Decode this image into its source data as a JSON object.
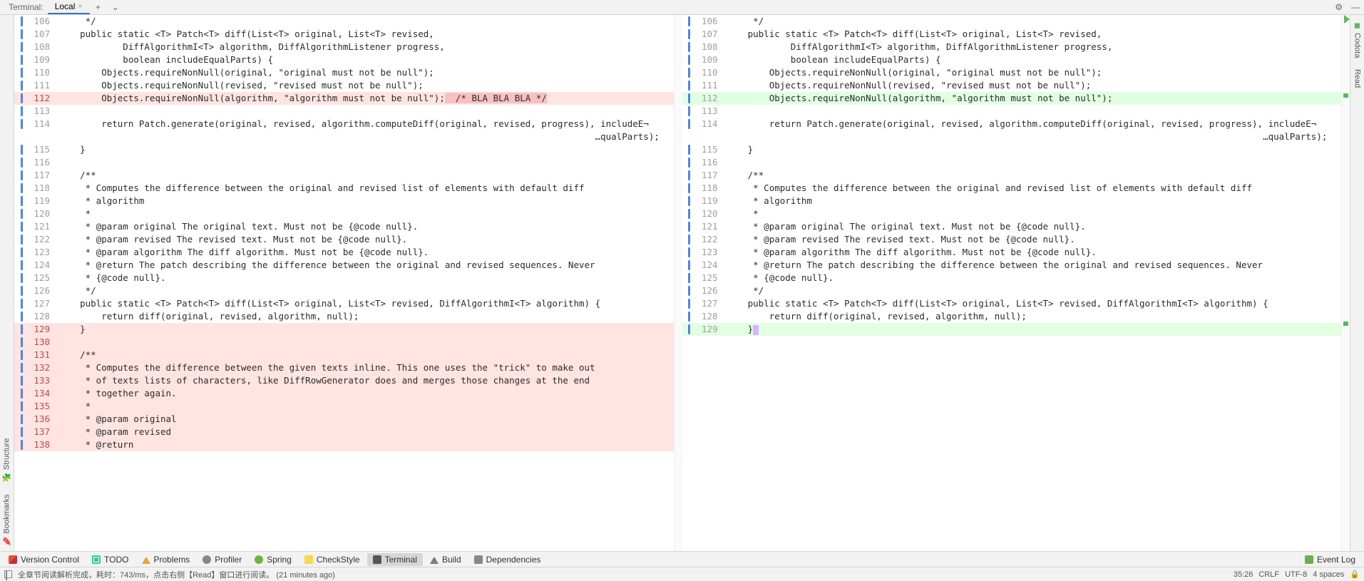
{
  "toptabs": {
    "label": "Terminal:",
    "active_tab": "Local",
    "plus": "+",
    "chevron": "⌄",
    "gear": "⚙",
    "minimize": "—"
  },
  "leftstrip": {
    "structure": "Structure",
    "bookmarks": "Bookmarks"
  },
  "rightstrip": {
    "codota": "Codota",
    "read": "Read"
  },
  "left_pane": {
    "lines": [
      {
        "n": 106,
        "t": "     */",
        "cls": ""
      },
      {
        "n": 107,
        "t": "    public static <T> Patch<T> diff(List<T> original, List<T> revised,",
        "cls": ""
      },
      {
        "n": 108,
        "t": "            DiffAlgorithmI<T> algorithm, DiffAlgorithmListener progress,",
        "cls": ""
      },
      {
        "n": 109,
        "t": "            boolean includeEqualParts) {",
        "cls": ""
      },
      {
        "n": 110,
        "t": "        Objects.requireNonNull(original, \"original must not be null\");",
        "cls": ""
      },
      {
        "n": 111,
        "t": "        Objects.requireNonNull(revised, \"revised must not be null\");",
        "cls": ""
      },
      {
        "n": 112,
        "t": "        Objects.requireNonNull(algorithm, \"algorithm must not be null\");",
        "cls": "del",
        "trail": "  /* BLA BLA BLA */"
      },
      {
        "n": 113,
        "t": "",
        "cls": ""
      },
      {
        "n": 114,
        "t": "        return Patch.generate(original, revised, algorithm.computeDiff(original, revised, progress), includeE¬",
        "cls": ""
      },
      {
        "n": 0,
        "t": "                                                                                                    …qualParts);",
        "cls": "",
        "nogut": true
      },
      {
        "n": 115,
        "t": "    }",
        "cls": ""
      },
      {
        "n": 116,
        "t": "",
        "cls": ""
      },
      {
        "n": 117,
        "t": "    /**",
        "cls": ""
      },
      {
        "n": 118,
        "t": "     * Computes the difference between the original and revised list of elements with default diff",
        "cls": ""
      },
      {
        "n": 119,
        "t": "     * algorithm",
        "cls": ""
      },
      {
        "n": 120,
        "t": "     *",
        "cls": ""
      },
      {
        "n": 121,
        "t": "     * @param original The original text. Must not be {@code null}.",
        "cls": ""
      },
      {
        "n": 122,
        "t": "     * @param revised The revised text. Must not be {@code null}.",
        "cls": ""
      },
      {
        "n": 123,
        "t": "     * @param algorithm The diff algorithm. Must not be {@code null}.",
        "cls": ""
      },
      {
        "n": 124,
        "t": "     * @return The patch describing the difference between the original and revised sequences. Never",
        "cls": ""
      },
      {
        "n": 125,
        "t": "     * {@code null}.",
        "cls": ""
      },
      {
        "n": 126,
        "t": "     */",
        "cls": ""
      },
      {
        "n": 127,
        "t": "    public static <T> Patch<T> diff(List<T> original, List<T> revised, DiffAlgorithmI<T> algorithm) {",
        "cls": ""
      },
      {
        "n": 128,
        "t": "        return diff(original, revised, algorithm, null);",
        "cls": ""
      },
      {
        "n": 129,
        "t": "    }",
        "cls": "del"
      },
      {
        "n": 130,
        "t": "",
        "cls": "del"
      },
      {
        "n": 131,
        "t": "    /**",
        "cls": "del"
      },
      {
        "n": 132,
        "t": "     * Computes the difference between the given texts inline. This one uses the \"trick\" to make out",
        "cls": "del"
      },
      {
        "n": 133,
        "t": "     * of texts lists of characters, like DiffRowGenerator does and merges those changes at the end",
        "cls": "del"
      },
      {
        "n": 134,
        "t": "     * together again.",
        "cls": "del"
      },
      {
        "n": 135,
        "t": "     *",
        "cls": "del"
      },
      {
        "n": 136,
        "t": "     * @param original",
        "cls": "del"
      },
      {
        "n": 137,
        "t": "     * @param revised",
        "cls": "del"
      },
      {
        "n": 138,
        "t": "     * @return",
        "cls": "del"
      }
    ]
  },
  "right_pane": {
    "lines": [
      {
        "n": 106,
        "t": "     */",
        "cls": ""
      },
      {
        "n": 107,
        "t": "    public static <T> Patch<T> diff(List<T> original, List<T> revised,",
        "cls": ""
      },
      {
        "n": 108,
        "t": "            DiffAlgorithmI<T> algorithm, DiffAlgorithmListener progress,",
        "cls": ""
      },
      {
        "n": 109,
        "t": "            boolean includeEqualParts) {",
        "cls": ""
      },
      {
        "n": 110,
        "t": "        Objects.requireNonNull(original, \"original must not be null\");",
        "cls": ""
      },
      {
        "n": 111,
        "t": "        Objects.requireNonNull(revised, \"revised must not be null\");",
        "cls": ""
      },
      {
        "n": 112,
        "t": "        Objects.requireNonNull(algorithm, \"algorithm must not be null\");",
        "cls": "ins"
      },
      {
        "n": 113,
        "t": "",
        "cls": ""
      },
      {
        "n": 114,
        "t": "        return Patch.generate(original, revised, algorithm.computeDiff(original, revised, progress), includeE¬",
        "cls": ""
      },
      {
        "n": 0,
        "t": "                                                                                                    …qualParts);",
        "cls": "",
        "nogut": true
      },
      {
        "n": 115,
        "t": "    }",
        "cls": ""
      },
      {
        "n": 116,
        "t": "",
        "cls": ""
      },
      {
        "n": 117,
        "t": "    /**",
        "cls": ""
      },
      {
        "n": 118,
        "t": "     * Computes the difference between the original and revised list of elements with default diff",
        "cls": ""
      },
      {
        "n": 119,
        "t": "     * algorithm",
        "cls": ""
      },
      {
        "n": 120,
        "t": "     *",
        "cls": ""
      },
      {
        "n": 121,
        "t": "     * @param original The original text. Must not be {@code null}.",
        "cls": ""
      },
      {
        "n": 122,
        "t": "     * @param revised The revised text. Must not be {@code null}.",
        "cls": ""
      },
      {
        "n": 123,
        "t": "     * @param algorithm The diff algorithm. Must not be {@code null}.",
        "cls": ""
      },
      {
        "n": 124,
        "t": "     * @return The patch describing the difference between the original and revised sequences. Never",
        "cls": ""
      },
      {
        "n": 125,
        "t": "     * {@code null}.",
        "cls": ""
      },
      {
        "n": 126,
        "t": "     */",
        "cls": ""
      },
      {
        "n": 127,
        "t": "    public static <T> Patch<T> diff(List<T> original, List<T> revised, DiffAlgorithmI<T> algorithm) {",
        "cls": ""
      },
      {
        "n": 128,
        "t": "        return diff(original, revised, algorithm, null);",
        "cls": ""
      },
      {
        "n": 129,
        "t": "    }",
        "cls": "ins",
        "caret": true
      }
    ]
  },
  "bottomtools": {
    "version_control": "Version Control",
    "todo": "TODO",
    "problems": "Problems",
    "profiler": "Profiler",
    "spring": "Spring",
    "checkstyle": "CheckStyle",
    "terminal": "Terminal",
    "build": "Build",
    "dependencies": "Dependencies",
    "event_log": "Event Log"
  },
  "statusbar": {
    "msg": "全章节阅读解析完成，耗时：743/ms，点击右侧【Read】窗口进行阅读。 (21 minutes ago)",
    "pos": "35:26",
    "crlf": "CRLF",
    "enc": "UTF-8",
    "indent": "4 spaces",
    "lock": "🔒"
  }
}
